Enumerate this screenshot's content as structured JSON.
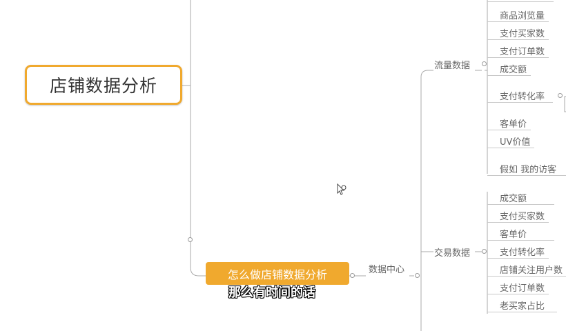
{
  "mindmap": {
    "root": "店铺数据分析",
    "highlighted_node": "怎么做店铺数据分析",
    "data_center": "数据中心",
    "traffic": {
      "label": "流量数据",
      "items": [
        "商品浏览量",
        "支付买家数",
        "支付订单数",
        "成交额",
        "支付转化率",
        "客单价",
        "UV价值",
        "假如  我的访客"
      ]
    },
    "transaction": {
      "label": "交易数据",
      "items": [
        "成交额",
        "支付买家数",
        "客单价",
        "支付转化率",
        "店铺关注用户数",
        "支付订单数",
        "老买家占比"
      ]
    }
  },
  "subtitle": "那么有时间的话",
  "colors": {
    "accent": "#f0a92e",
    "line": "#aaaaaa"
  }
}
